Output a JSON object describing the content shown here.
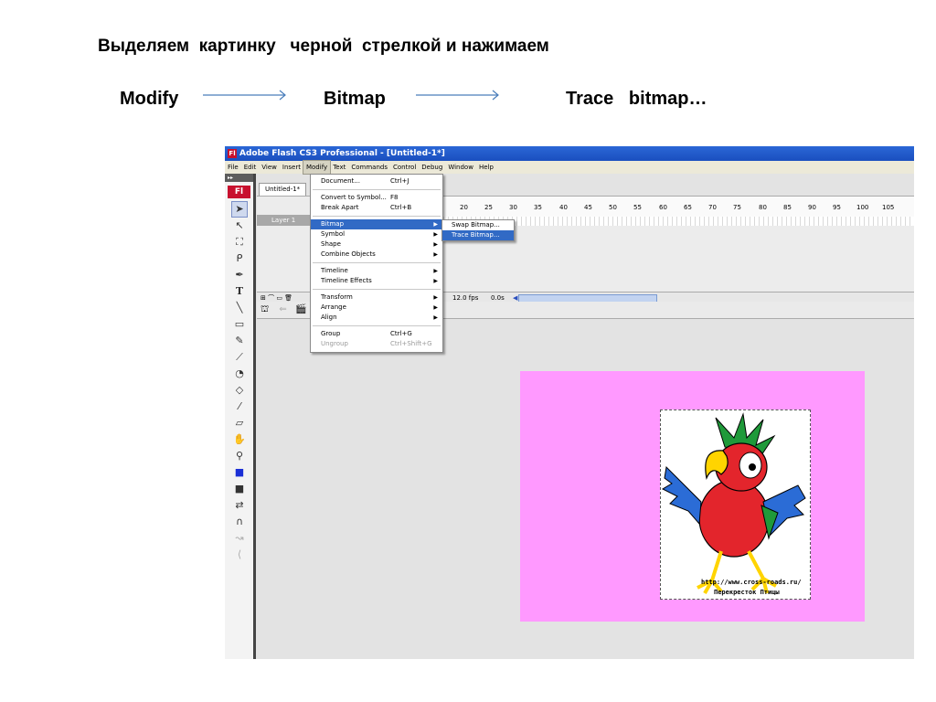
{
  "slide": {
    "title": "Выделяем  картинку   черной  стрелкой и нажимаем",
    "steps": [
      "Modify",
      "Bitmap",
      "Trace   bitmap…"
    ]
  },
  "window": {
    "title": "Adobe Flash CS3 Professional - [Untitled-1*]",
    "icon_label": "Fl",
    "menu": [
      "File",
      "Edit",
      "View",
      "Insert",
      "Modify",
      "Text",
      "Commands",
      "Control",
      "Debug",
      "Window",
      "Help"
    ],
    "active_menu": "Modify",
    "doc_tab": "Untitled-1*",
    "layer_name": "Layer 1",
    "fps": "12.0 fps",
    "time": "0.0s",
    "ruler": [
      "20",
      "25",
      "30",
      "35",
      "40",
      "45",
      "50",
      "55",
      "60",
      "65",
      "70",
      "75",
      "80",
      "85",
      "90",
      "95",
      "100",
      "105"
    ]
  },
  "modify_menu": {
    "document": "Document...",
    "document_sc": "Ctrl+J",
    "convert": "Convert to Symbol...",
    "convert_sc": "F8",
    "break_apart": "Break Apart",
    "break_apart_sc": "Ctrl+B",
    "bitmap": "Bitmap",
    "symbol": "Symbol",
    "shape": "Shape",
    "combine": "Combine Objects",
    "timeline": "Timeline",
    "timeline_effects": "Timeline Effects",
    "transform": "Transform",
    "arrange": "Arrange",
    "align": "Align",
    "group": "Group",
    "group_sc": "Ctrl+G",
    "ungroup": "Ungroup",
    "ungroup_sc": "Ctrl+Shift+G"
  },
  "bitmap_submenu": {
    "swap": "Swap Bitmap...",
    "trace": "Trace Bitmap..."
  },
  "stage": {
    "color": "#ff99ff",
    "caption_url": "http://www.cross-roads.ru/",
    "caption_name": "Перекресток Птицы"
  },
  "colors": {
    "highlight": "#316ac5",
    "titlebar": "#2b67d6",
    "stage": "#ff99ff"
  }
}
